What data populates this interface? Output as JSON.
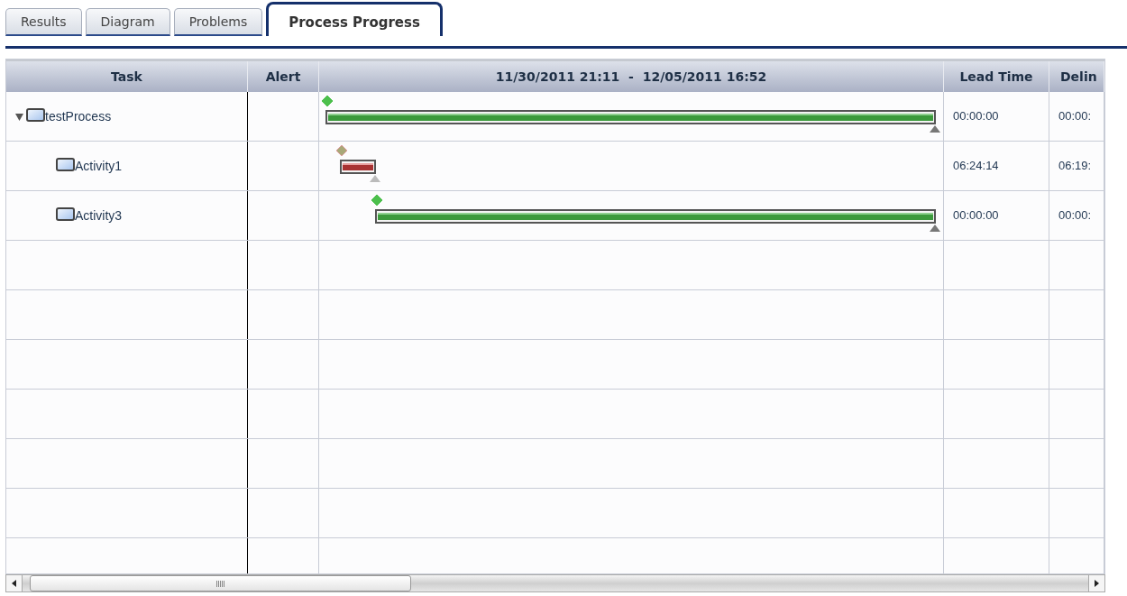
{
  "tabs": [
    {
      "label": "Results",
      "selected": false
    },
    {
      "label": "Diagram",
      "selected": false
    },
    {
      "label": "Problems",
      "selected": false
    },
    {
      "label": "Process Progress",
      "selected": true
    }
  ],
  "table": {
    "columns": [
      "Task",
      "Alert",
      "11/30/2011 21:11  -  12/05/2011 16:52",
      "Lead Time",
      "Delin"
    ],
    "rows": [
      {
        "task": "testProcess",
        "expanded": true,
        "late": false,
        "lead_time": "00:00:00",
        "column_5": "00:00:",
        "children": [
          {
            "task": "Activity1",
            "late": true,
            "lead_time": "06:24:14",
            "column_5": "06:19:"
          },
          {
            "task": "Activity3",
            "late": false,
            "lead_time": "00:00:00",
            "column_5": "00:00:"
          }
        ]
      }
    ]
  }
}
